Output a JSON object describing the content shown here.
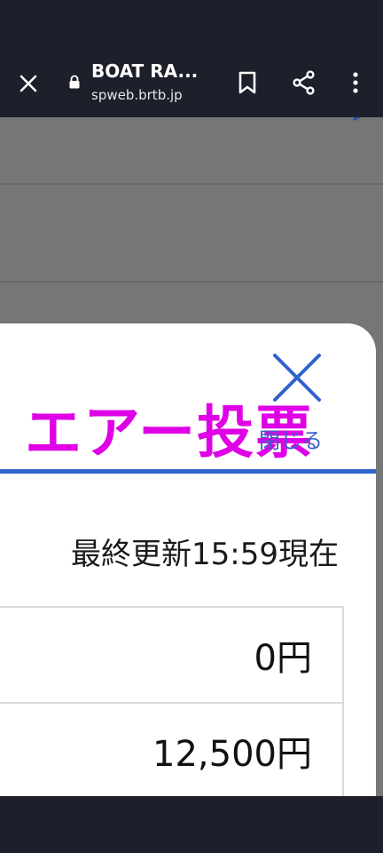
{
  "browser": {
    "title": "BOAT RA...",
    "url": "spweb.brtb.jp"
  },
  "modal": {
    "title": "エアー投票",
    "close_label": "閉じる",
    "updated": "最終更新15:59現在",
    "rows": [
      {
        "amount": "0円"
      },
      {
        "amount": "12,500円"
      }
    ]
  },
  "colors": {
    "title": "#e000e6",
    "accent": "#2f63cc",
    "toolbar": "#1d1f2b"
  }
}
